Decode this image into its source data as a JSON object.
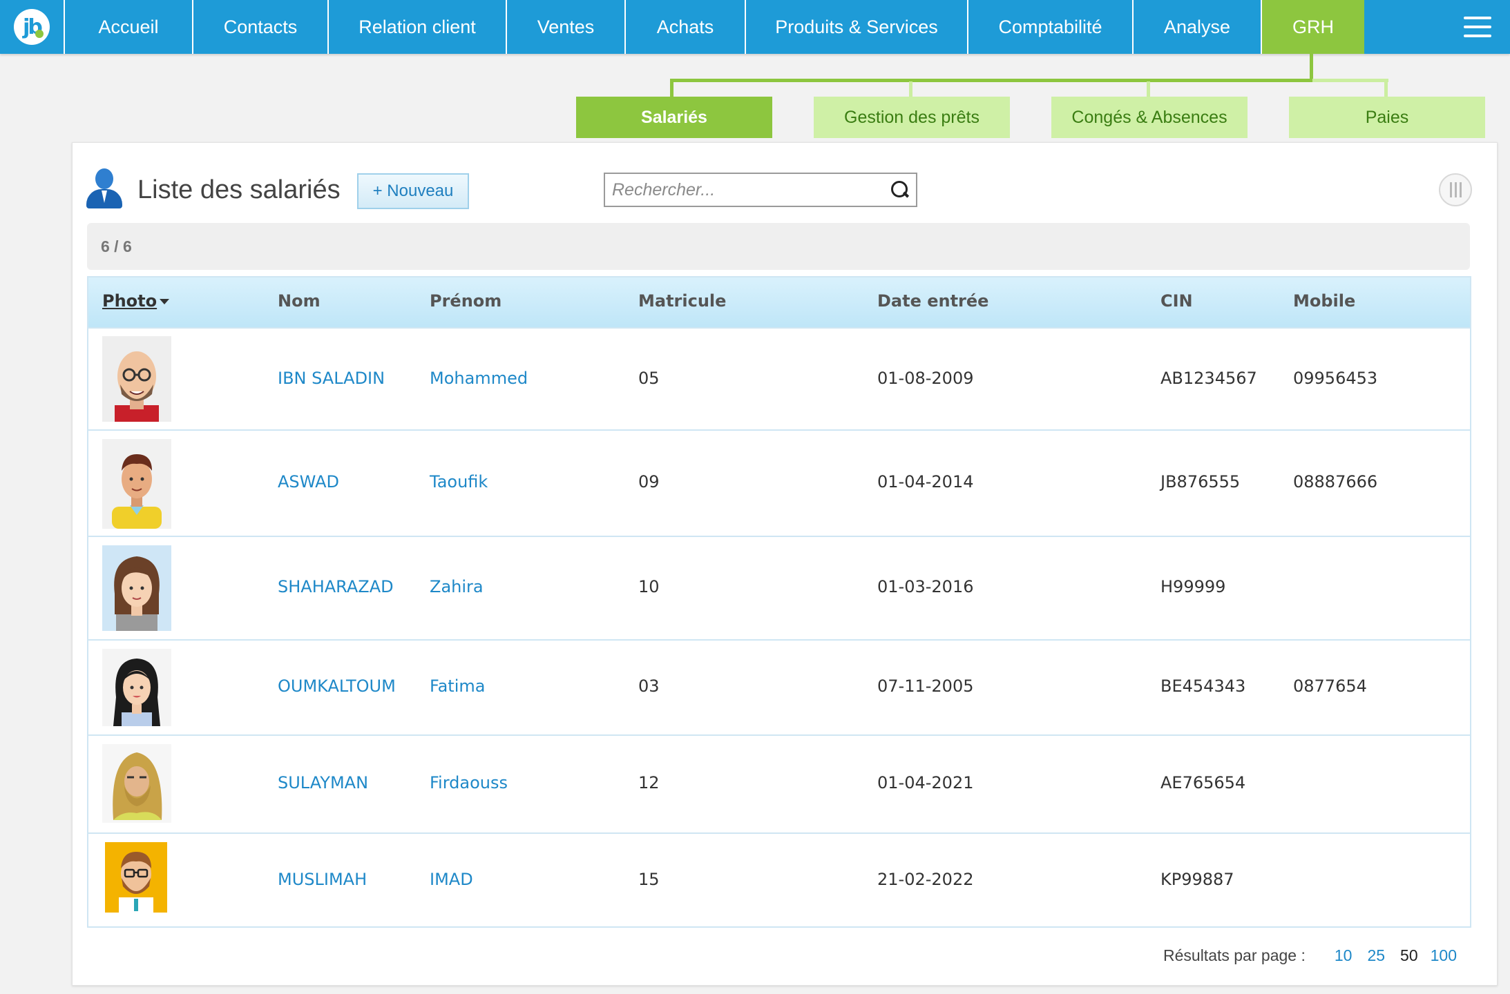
{
  "nav": {
    "items": [
      {
        "label": "Accueil",
        "active": false
      },
      {
        "label": "Contacts",
        "active": false
      },
      {
        "label": "Relation client",
        "active": false
      },
      {
        "label": "Ventes",
        "active": false
      },
      {
        "label": "Achats",
        "active": false
      },
      {
        "label": "Produits & Services",
        "active": false
      },
      {
        "label": "Comptabilité",
        "active": false
      },
      {
        "label": "Analyse",
        "active": false
      },
      {
        "label": "GRH",
        "active": true
      }
    ],
    "logo_icon": "jb-logo-icon",
    "menu_icon": "hamburger-menu-icon",
    "brand_color": "#1e9bd7",
    "active_color": "#8dc63f"
  },
  "subtabs": [
    {
      "label": "Salariés",
      "active": true
    },
    {
      "label": "Gestion des prêts",
      "active": false
    },
    {
      "label": "Congés & Absences",
      "active": false
    },
    {
      "label": "Paies",
      "active": false
    }
  ],
  "header": {
    "title": "Liste des salariés",
    "new_button": "+ Nouveau",
    "title_icon": "user-icon"
  },
  "search": {
    "placeholder": "Rechercher...",
    "value": "",
    "icon": "search-icon"
  },
  "count": "6 / 6",
  "table": {
    "columns": [
      "Photo",
      "Nom",
      "Prénom",
      "Matricule",
      "Date entrée",
      "CIN",
      "Mobile"
    ],
    "sorted_column": "Photo",
    "rows": [
      {
        "avatar": "bald-man-glasses-avatar",
        "nom": "IBN SALADIN",
        "prenom": "Mohammed",
        "matricule": "05",
        "date_entree": "01-08-2009",
        "cin": "AB1234567",
        "mobile": "09956453"
      },
      {
        "avatar": "man-yellow-sweater-avatar",
        "nom": "ASWAD",
        "prenom": "Taoufik",
        "matricule": "09",
        "date_entree": "01-04-2014",
        "cin": "JB876555",
        "mobile": "08887666"
      },
      {
        "avatar": "woman-brown-hair-avatar",
        "nom": "SHAHARAZAD",
        "prenom": "Zahira",
        "matricule": "10",
        "date_entree": "01-03-2016",
        "cin": "H99999",
        "mobile": ""
      },
      {
        "avatar": "woman-black-hair-avatar",
        "nom": "OUMKALTOUM",
        "prenom": "Fatima",
        "matricule": "03",
        "date_entree": "07-11-2005",
        "cin": "BE454343",
        "mobile": "0877654"
      },
      {
        "avatar": "woman-hijab-avatar",
        "nom": "SULAYMAN",
        "prenom": "Firdaouss",
        "matricule": "12",
        "date_entree": "01-04-2021",
        "cin": "AE765654",
        "mobile": ""
      },
      {
        "avatar": "bearded-man-glasses-avatar",
        "nom": "MUSLIMAH",
        "prenom": "IMAD",
        "matricule": "15",
        "date_entree": "21-02-2022",
        "cin": "KP99887",
        "mobile": ""
      }
    ]
  },
  "pagination": {
    "label": "Résultats par page :",
    "options": [
      "10",
      "25",
      "50",
      "100"
    ],
    "selected": "50"
  }
}
